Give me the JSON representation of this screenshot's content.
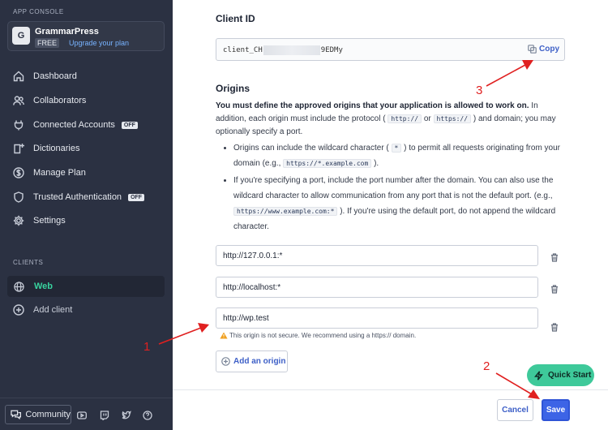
{
  "sidebar": {
    "console_label": "APP CONSOLE",
    "workspace": {
      "avatar": "G",
      "name": "GrammarPress",
      "plan": "FREE",
      "upgrade": "Upgrade your plan"
    },
    "nav": [
      {
        "label": "Dashboard",
        "icon": "home-icon"
      },
      {
        "label": "Collaborators",
        "icon": "users-icon"
      },
      {
        "label": "Connected Accounts",
        "icon": "plug-icon",
        "badge": "OFF"
      },
      {
        "label": "Dictionaries",
        "icon": "book-plus-icon"
      },
      {
        "label": "Manage Plan",
        "icon": "dollar-icon"
      },
      {
        "label": "Trusted Authentication",
        "icon": "shield-icon",
        "badge": "OFF"
      },
      {
        "label": "Settings",
        "icon": "gear-icon"
      }
    ],
    "clients_label": "CLIENTS",
    "active_client": "Web",
    "add_client": "Add client",
    "community": "Community"
  },
  "main": {
    "client_id_title": "Client ID",
    "client_id_prefix": "client_CH",
    "client_id_suffix": "9EDMy",
    "copy_label": "Copy",
    "origins_title": "Origins",
    "intro_bold": "You must define the approved origins that your application is allowed to work on.",
    "intro_1": " In addition, each origin must include the protocol (",
    "code_http": "http://",
    "intro_or": " or ",
    "code_https": "https://",
    "intro_2": ") and domain; you may optionally specify a port.",
    "bullet1_a": "Origins can include the wildcard character (",
    "code_star": "*",
    "bullet1_b": ") to permit all requests originating from your domain (e.g.,",
    "code_wild": "https://*.example.com",
    "bullet1_c": ").",
    "bullet2_a": "If you're specifying a port, include the port number after the domain. You can also use the wildcard character to allow communication from any port that is not the default port. (e.g.,",
    "code_port": "https://www.example.com:*",
    "bullet2_b": "). If you're using the default port, do not append the wildcard character.",
    "origins": [
      "http://127.0.0.1:*",
      "http://localhost:*",
      "http://wp.test"
    ],
    "warning": "This origin is not secure. We recommend using a https:// domain.",
    "add_origin": "Add an origin",
    "quick_start": "Quick Start",
    "cancel": "Cancel",
    "save": "Save"
  },
  "annotations": {
    "n1": "1",
    "n2": "2",
    "n3": "3"
  },
  "colors": {
    "sidebar_bg": "#2b3142",
    "accent_green": "#38d39f",
    "primary_blue": "#3d64e6",
    "annotation_red": "#e02020"
  }
}
